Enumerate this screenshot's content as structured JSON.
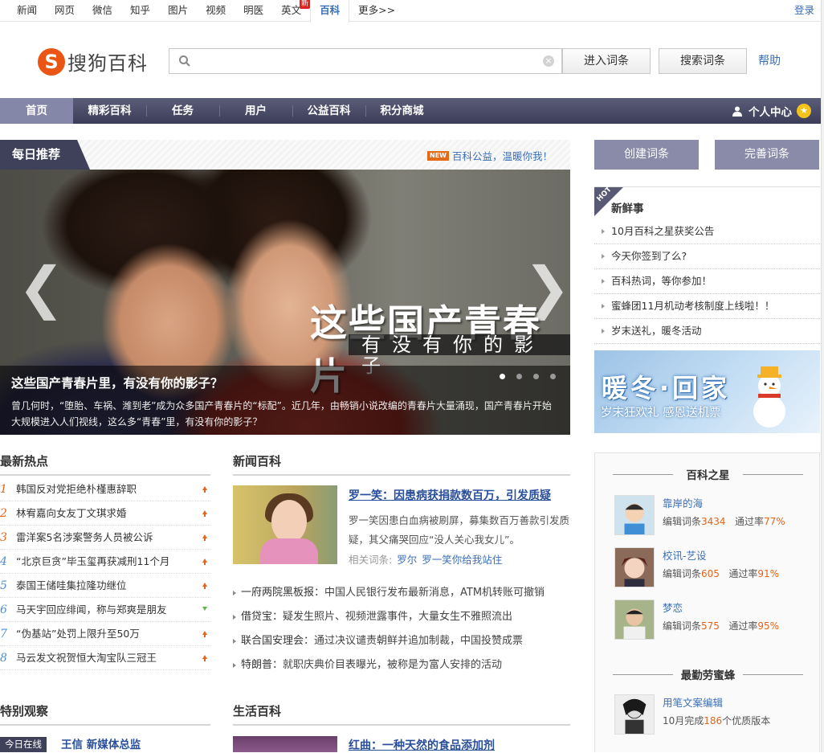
{
  "topnav": {
    "items": [
      "新闻",
      "网页",
      "微信",
      "知乎",
      "图片",
      "视频",
      "明医",
      "英文",
      "百科",
      "更多>>"
    ],
    "new_badge": "新",
    "login": "登录"
  },
  "header": {
    "logo_mark": "S",
    "logo_text": "搜狗百科",
    "search_placeholder": "",
    "enter_button": "进入词条",
    "search_button": "搜索词条",
    "help": "帮助"
  },
  "mainnav": {
    "items": [
      "首页",
      "精彩百科",
      "任务",
      "用户",
      "公益百科",
      "积分商城"
    ],
    "user_center": "个人中心"
  },
  "daily": {
    "title": "每日推荐",
    "new_tag": "NEW",
    "link": "百科公益，温暖你我！",
    "overlay_big": "这些国产青春片",
    "overlay_small": "有没有你的影子",
    "caption_title": "这些国产青春片里，有没有你的影子？",
    "caption_desc": "曾几何时，“堕胎、车祸、潍到老”成为众多国产青春片的“标配”。近几年，由畅销小说改编的青春片大量涌现，国产青春片开始大规模进入人们视线，这么多“青春”里，有没有你的影子？",
    "arrow_left": "❮",
    "arrow_right": "❯"
  },
  "right": {
    "create_button": "创建词条",
    "improve_button": "完善词条",
    "hot_tag": "HOT",
    "fresh_title": "新鲜事",
    "fresh_items": [
      "10月百科之星获奖公告",
      "今天你签到了么?",
      "百科热词，等你参加！",
      "蜜蜂团11月机动考核制度上线啦！！",
      "岁末送礼，暖冬活动"
    ],
    "winter_big": "暖冬·回家",
    "winter_small": "岁末狂欢礼 感恩送机票",
    "stars_title": "百科之星",
    "edit_label": "编辑词条",
    "pass_label": "通过率",
    "stars": [
      {
        "name": "靠岸的海",
        "edits": "3434",
        "rate": "77%"
      },
      {
        "name": "校讯-艺设",
        "edits": "605",
        "rate": "91%"
      },
      {
        "name": "梦恋",
        "edits": "575",
        "rate": "95%"
      }
    ],
    "bees_title": "最勤劳蜜蜂",
    "bee": {
      "name": "用笔文案编辑",
      "prefix": "10月完成",
      "count": "186",
      "suffix": "个优质版本"
    }
  },
  "hot": {
    "title": "最新热点",
    "items": [
      {
        "n": "1",
        "t": "韩国反对党拒绝朴槿惠辞职",
        "trend": "up"
      },
      {
        "n": "2",
        "t": "林宥嘉向女友丁文琪求婚",
        "trend": "up"
      },
      {
        "n": "3",
        "t": "雷洋案5名涉案警务人员被公诉",
        "trend": "up"
      },
      {
        "n": "4",
        "t": "“北京巨贪”毕玉玺再获减刑11个月",
        "trend": "up"
      },
      {
        "n": "5",
        "t": "泰国王储哇集拉隆功继位",
        "trend": "up"
      },
      {
        "n": "6",
        "t": "马天宇回应绯闻，称与郑爽是朋友",
        "trend": "down"
      },
      {
        "n": "7",
        "t": "“伪基站”处罚上限升至50万",
        "trend": "up"
      },
      {
        "n": "8",
        "t": "马云发文祝贺恒大淘宝队三冠王",
        "trend": "up"
      }
    ]
  },
  "news": {
    "title": "新闻百科",
    "headline": "罗一笑：因患病获捐款数百万，引发质疑",
    "desc": "罗一笑因患白血病被刷屏，募集数百万善款引发质疑，其父痛哭回应“没人关心我女儿”。",
    "related_label": "相关词条:",
    "related": [
      "罗尔",
      "罗一笑你给我站住"
    ],
    "list": [
      {
        "k": "一府两院黑板报",
        "t": "：中国人民银行发布最新消息，ATM机转账可撤销"
      },
      {
        "k": "借贷宝",
        "t": "：疑发生照片、视频泄露事件，大量女生不雅照流出"
      },
      {
        "k": "联合国安理会",
        "t": "：通过决议谴责朝鲜并追加制裁，中国投赞成票"
      },
      {
        "k": "特朗普",
        "t": "：就职庆典价目表曝光，被称是为富人安排的活动"
      }
    ]
  },
  "special": {
    "title": "特别观察",
    "tag": "今日在线",
    "text": "王信 新媒体总监"
  },
  "life": {
    "title": "生活百科",
    "headline": "红曲：一种天然的食品添加剂"
  },
  "colors": {
    "nav": "#3c3d58",
    "accent": "#e5641b",
    "link": "#3b6fb6"
  }
}
